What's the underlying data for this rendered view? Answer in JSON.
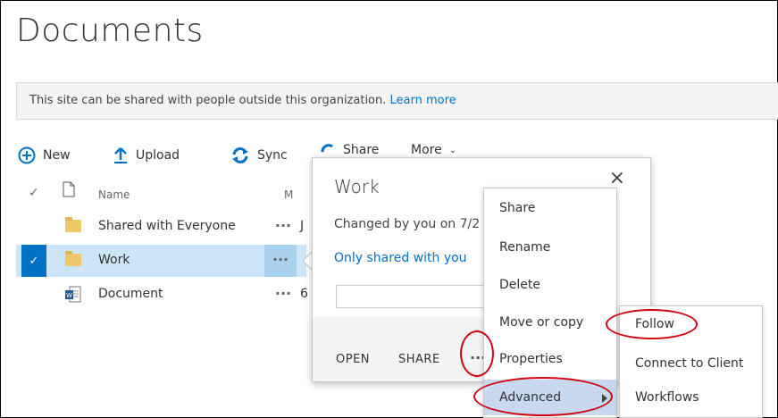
{
  "page": {
    "title": "Documents"
  },
  "banner": {
    "text": "This site can be shared with people outside this organization.",
    "link": "Learn more"
  },
  "toolbar": {
    "new_label": "New",
    "upload_label": "Upload",
    "sync_label": "Sync",
    "share_label": "Share",
    "more_label": "More"
  },
  "list": {
    "columns": {
      "name": "Name",
      "modified": "M"
    },
    "rows": [
      {
        "name": "Shared with Everyone",
        "ellipsis": "...",
        "date": "J",
        "selected": false,
        "type": "folder"
      },
      {
        "name": "Work",
        "ellipsis": "...",
        "date": "",
        "selected": true,
        "type": "folder",
        "check": "✓"
      },
      {
        "name": "Document",
        "ellipsis": "...",
        "date": "6",
        "selected": false,
        "type": "word-doc"
      }
    ]
  },
  "callout": {
    "title": "Work",
    "close": "×",
    "changed": "Changed by you on 7/2",
    "shared": "Only shared with you",
    "footer": {
      "open": "OPEN",
      "share": "SHARE",
      "more": "..."
    }
  },
  "context_menu": {
    "items": [
      "Share",
      "Rename",
      "Delete",
      "Move or copy",
      "Properties",
      "Advanced"
    ]
  },
  "advanced_submenu": {
    "items": [
      "Follow",
      "Connect to Client",
      "Workflows"
    ]
  },
  "colors": {
    "accent": "#0072c6",
    "selected_row": "#cde6f7",
    "highlight_item": "#c7d8ef",
    "annotation": "#d00010"
  },
  "icons": [
    "plus-circle-icon",
    "upload-arrow-icon",
    "sync-icon",
    "share-icon",
    "chevron-down-icon",
    "checkmark-icon",
    "document-icon",
    "folder-icon",
    "word-file-icon",
    "close-icon",
    "chevron-right-icon"
  ]
}
